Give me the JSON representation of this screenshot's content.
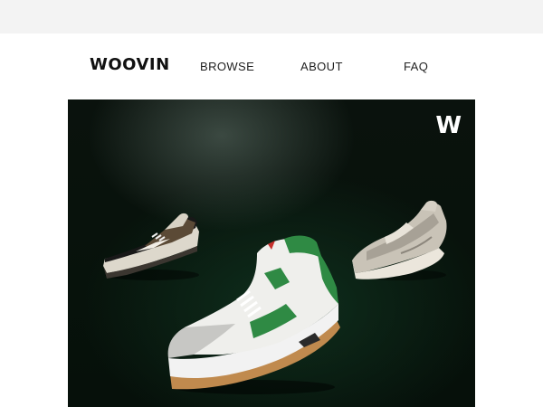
{
  "top_strip": {},
  "header": {
    "logo": "WOOVIN",
    "nav": [
      {
        "label": "BROWSE"
      },
      {
        "label": "ABOUT"
      },
      {
        "label": "FAQ"
      }
    ]
  },
  "hero": {
    "brand_mark": "W",
    "background": "#0b1f13",
    "accent_green": "#2f8a44",
    "products": [
      {
        "icon": "sneaker-black-tan-low-icon"
      },
      {
        "icon": "sneaker-white-green-high-icon"
      },
      {
        "icon": "sneaker-grey-runner-icon"
      }
    ]
  }
}
